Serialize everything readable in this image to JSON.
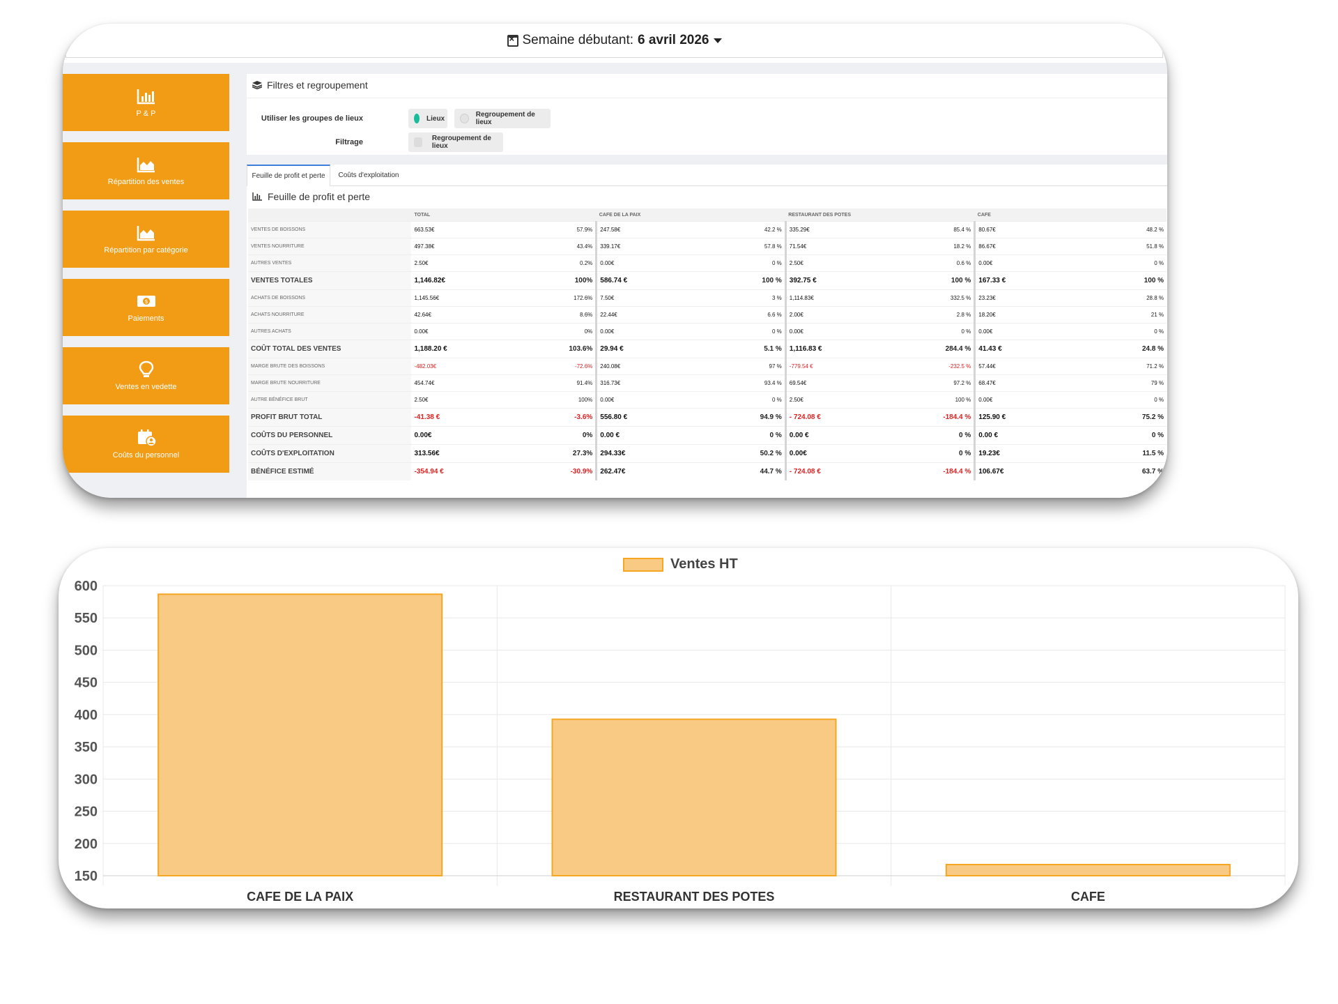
{
  "header": {
    "week_prefix": "Semaine débutant:",
    "week_date": "6 avril 2026"
  },
  "sidebar": {
    "items": [
      {
        "label": "P & P",
        "icon": "bar-chart-icon"
      },
      {
        "label": "Répartition des ventes",
        "icon": "area-chart-icon"
      },
      {
        "label": "Répartition par catégorie",
        "icon": "area-chart-icon"
      },
      {
        "label": "Paiements",
        "icon": "money-icon"
      },
      {
        "label": "Ventes en vedette",
        "icon": "lightbulb-icon"
      },
      {
        "label": "Coûts du personnel",
        "icon": "calendar-user-icon"
      }
    ]
  },
  "filters": {
    "title": "Filtres et regroupement",
    "group_label": "Utiliser les groupes de lieux",
    "radio_lieux": "Lieux",
    "radio_regroupement": "Regroupement de lieux",
    "filter_label": "Filtrage",
    "filter_checkbox": "Regroupement de lieux"
  },
  "tabs": [
    "Feuille de profit et perte",
    "Coûts d'exploitation"
  ],
  "pl": {
    "title": "Feuille de profit et perte",
    "columns": [
      "TOTAL",
      "CAFE DE LA PAIX",
      "RESTAURANT DES POTES",
      "CAFE"
    ],
    "rows": [
      {
        "label": "Ventes de boissons",
        "big": false,
        "cells": [
          [
            "663.53€",
            "57.9%"
          ],
          [
            "247.58€",
            "42.2 %"
          ],
          [
            "335.29€",
            "85.4 %"
          ],
          [
            "80.67€",
            "48.2 %"
          ]
        ]
      },
      {
        "label": "Ventes nourriture",
        "big": false,
        "cells": [
          [
            "497.38€",
            "43.4%"
          ],
          [
            "339.17€",
            "57.8 %"
          ],
          [
            "71.54€",
            "18.2 %"
          ],
          [
            "86.67€",
            "51.8 %"
          ]
        ]
      },
      {
        "label": "Autres ventes",
        "big": false,
        "cells": [
          [
            "2.50€",
            "0.2%"
          ],
          [
            "0.00€",
            "0 %"
          ],
          [
            "2.50€",
            "0.6 %"
          ],
          [
            "0.00€",
            "0 %"
          ]
        ]
      },
      {
        "label": "VENTES TOTALES",
        "big": true,
        "cells": [
          [
            "1,146.82€",
            "100%"
          ],
          [
            "586.74 €",
            "100 %"
          ],
          [
            "392.75 €",
            "100 %"
          ],
          [
            "167.33 €",
            "100 %"
          ]
        ]
      },
      {
        "label": "Achats de boissons",
        "big": false,
        "cells": [
          [
            "1,145.56€",
            "172.6%"
          ],
          [
            "7.50€",
            "3 %"
          ],
          [
            "1,114.83€",
            "332.5 %"
          ],
          [
            "23.23€",
            "28.8 %"
          ]
        ]
      },
      {
        "label": "Achats nourriture",
        "big": false,
        "cells": [
          [
            "42.64€",
            "8.6%"
          ],
          [
            "22.44€",
            "6.6 %"
          ],
          [
            "2.00€",
            "2.8 %"
          ],
          [
            "18.20€",
            "21 %"
          ]
        ]
      },
      {
        "label": "Autres achats",
        "big": false,
        "cells": [
          [
            "0.00€",
            "0%"
          ],
          [
            "0.00€",
            "0 %"
          ],
          [
            "0.00€",
            "0 %"
          ],
          [
            "0.00€",
            "0 %"
          ]
        ]
      },
      {
        "label": "COÛT TOTAL DES VENTES",
        "big": true,
        "cells": [
          [
            "1,188.20 €",
            "103.6%"
          ],
          [
            "29.94 €",
            "5.1 %"
          ],
          [
            "1,116.83 €",
            "284.4 %"
          ],
          [
            "41.43 €",
            "24.8 %"
          ]
        ]
      },
      {
        "label": "Marge brute des boissons",
        "big": false,
        "cells": [
          [
            "-482.03€",
            "-72.6%",
            "neg"
          ],
          [
            "240.08€",
            "97 %"
          ],
          [
            "-779.54 €",
            "-232.5 %",
            "neg"
          ],
          [
            "57.44€",
            "71.2 %"
          ]
        ]
      },
      {
        "label": "Marge brute nourriture",
        "big": false,
        "cells": [
          [
            "454.74€",
            "91.4%"
          ],
          [
            "316.73€",
            "93.4 %"
          ],
          [
            "69.54€",
            "97.2 %"
          ],
          [
            "68.47€",
            "79 %"
          ]
        ]
      },
      {
        "label": "Autre bénéfice brut",
        "big": false,
        "cells": [
          [
            "2.50€",
            "100%"
          ],
          [
            "0.00€",
            "0 %"
          ],
          [
            "2.50€",
            "100 %"
          ],
          [
            "0.00€",
            "0 %"
          ]
        ]
      },
      {
        "label": "PROFIT BRUT TOTAL",
        "big": true,
        "cells": [
          [
            "-41.38 €",
            "-3.6%",
            "neg"
          ],
          [
            "556.80 €",
            "94.9 %"
          ],
          [
            "- 724.08 €",
            "-184.4 %",
            "neg"
          ],
          [
            "125.90 €",
            "75.2 %"
          ]
        ]
      },
      {
        "label": "COÛTS DU PERSONNEL",
        "big": true,
        "cells": [
          [
            "0.00€",
            "0%"
          ],
          [
            "0.00 €",
            "0 %"
          ],
          [
            "0.00 €",
            "0 %"
          ],
          [
            "0.00 €",
            "0 %"
          ]
        ]
      },
      {
        "label": "COÛTS D'EXPLOITATION",
        "big": true,
        "cells": [
          [
            "313.56€",
            "27.3%"
          ],
          [
            "294.33€",
            "50.2 %"
          ],
          [
            "0.00€",
            "0 %"
          ],
          [
            "19.23€",
            "11.5 %"
          ]
        ]
      },
      {
        "label": "BÉNÉFICE ESTIMÉ",
        "big": true,
        "cells": [
          [
            "-354.94 €",
            "-30.9%",
            "neg"
          ],
          [
            "262.47€",
            "44.7 %"
          ],
          [
            "- 724.08 €",
            "-184.4 %",
            "neg"
          ],
          [
            "106.67€",
            "63.7 %"
          ]
        ]
      }
    ]
  },
  "colors": {
    "accent": "#f29c16",
    "bar_fill": "#f8ca84",
    "bar_stroke": "#f5a623",
    "radio_on": "#1abc9c",
    "negative": "#e02020"
  },
  "chart_data": {
    "type": "bar",
    "categories": [
      "CAFE DE LA PAIX",
      "RESTAURANT DES POTES",
      "CAFE"
    ],
    "series": [
      {
        "name": "Ventes HT",
        "values": [
          586.74,
          392.75,
          167.33
        ]
      }
    ],
    "ylim": [
      150,
      600
    ],
    "yticks": [
      150,
      200,
      250,
      300,
      350,
      400,
      450,
      500,
      550,
      600
    ],
    "grid": true,
    "legend": "top-center"
  }
}
